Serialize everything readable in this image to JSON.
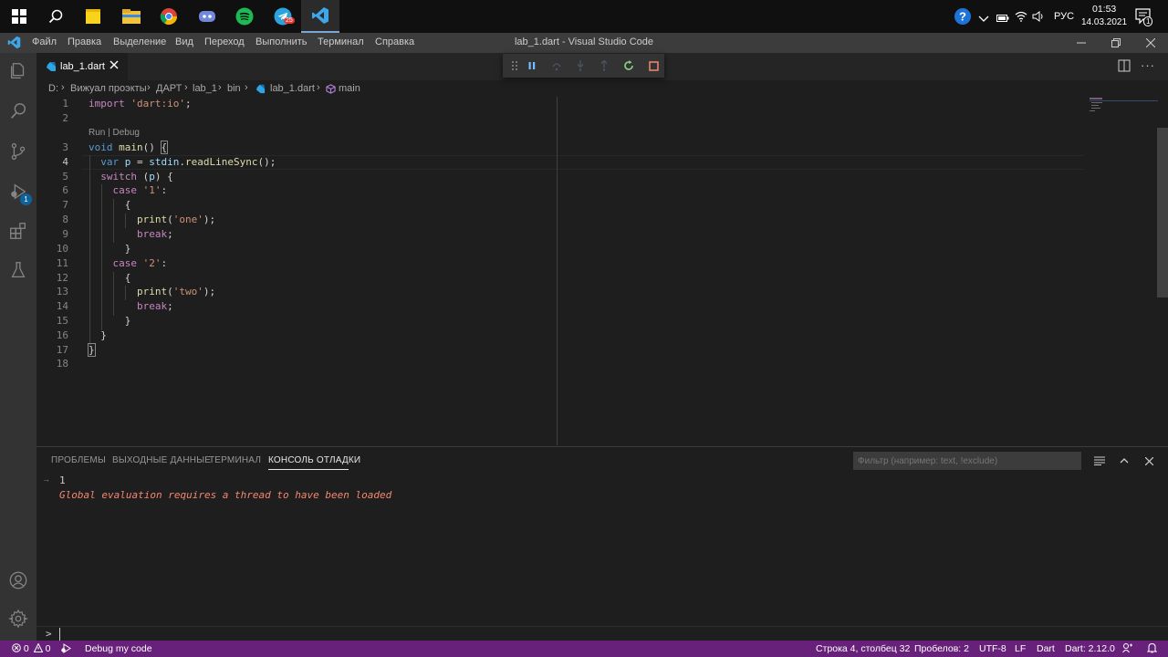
{
  "taskbar": {
    "tray_lang": "РУС",
    "clock_time": "01:53",
    "clock_date": "14.03.2021",
    "telegram_badge": "25",
    "notification_badge": "1"
  },
  "titlebar": {
    "title": "lab_1.dart - Visual Studio Code",
    "menus": [
      "Файл",
      "Правка",
      "Выделение",
      "Вид",
      "Переход",
      "Выполнить",
      "Терминал",
      "Справка"
    ]
  },
  "activity": {
    "debug_badge": "1"
  },
  "tab": {
    "label": "lab_1.dart"
  },
  "breadcrumb": {
    "items": [
      "D:",
      "Вижуал проэкты",
      "ДАРТ",
      "lab_1",
      "bin",
      "lab_1.dart",
      "main"
    ]
  },
  "editor": {
    "codelens": "Run | Debug",
    "line_numbers": [
      "1",
      "2",
      "3",
      "4",
      "5",
      "6",
      "7",
      "8",
      "9",
      "10",
      "11",
      "12",
      "13",
      "14",
      "15",
      "16",
      "17",
      "18"
    ],
    "current_line": "4"
  },
  "panel": {
    "tabs": [
      "ПРОБЛЕМЫ",
      "ВЫХОДНЫЕ ДАННЫЕ",
      "ТЕРМИНАЛ",
      "КОНСОЛЬ ОТЛАДКИ"
    ],
    "active_tab": "КОНСОЛЬ ОТЛАДКИ",
    "filter_placeholder": "Фильтр (например: text, !exclude)",
    "output": [
      "1",
      "Global evaluation requires a thread to have been loaded"
    ],
    "input_prompt": ">"
  },
  "statusbar": {
    "errors": "0",
    "warnings": "0",
    "debug_label": "Debug my code",
    "position": "Строка 4, столбец 32",
    "spaces": "Пробелов: 2",
    "encoding": "UTF-8",
    "eol": "LF",
    "language": "Dart",
    "sdk": "Dart: 2.12.0"
  },
  "colors": {
    "status_bar": "#68217a",
    "error_text": "#f48771",
    "accent": "#0e639c"
  }
}
